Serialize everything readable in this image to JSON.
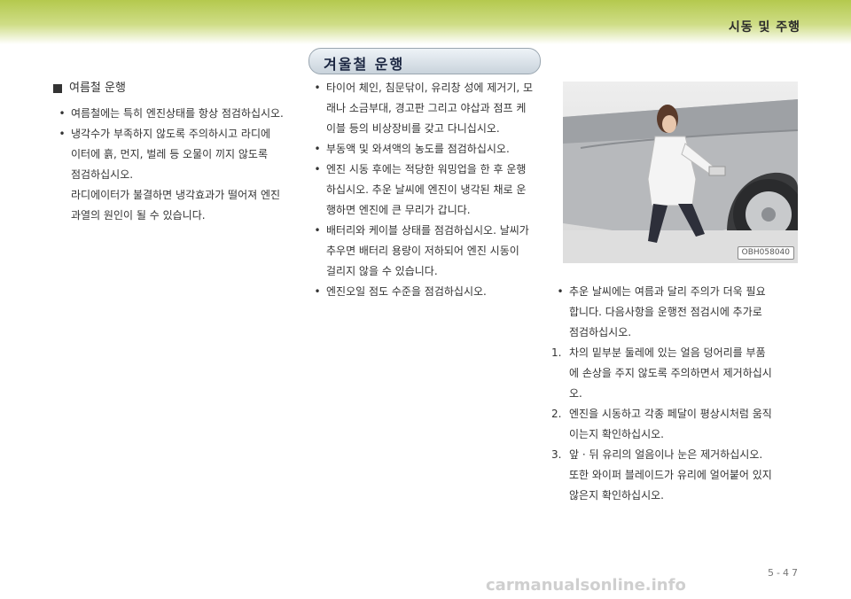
{
  "header": {
    "section_title": "시동 및 주행"
  },
  "banner": {
    "title": "겨울철 운행"
  },
  "summer": {
    "heading": "여름철 운행",
    "items": [
      {
        "lines": [
          "여름철에는 특히 엔진상태를 항상 점검하십시오."
        ]
      },
      {
        "lines": [
          "냉각수가 부족하지 않도록 주의하시고 라디에",
          "이터에 흙, 먼지, 벌레 등 오물이 끼지 않도록",
          "점검하십시오.",
          "라디에이터가 불결하면 냉각효과가 떨어져 엔진",
          "과열의 원인이 될 수 있습니다."
        ]
      }
    ]
  },
  "winter": {
    "items": [
      {
        "lines": [
          "타이어 체인, 침문닦이, 유리창 성에 제거기, 모",
          "래나 소금부대, 경고판 그리고 야삽과 점프 케",
          "이블 등의 비상장비를 갖고 다니십시오."
        ]
      },
      {
        "lines": [
          "부동액 및 와셔액의 농도를 점검하십시오."
        ]
      },
      {
        "lines": [
          "엔진 시동 후에는 적당한 워밍업을 한 후 운행",
          "하십시오. 추운 날씨에 엔진이 냉각된 채로 운",
          "행하면 엔진에 큰 무리가 갑니다."
        ]
      },
      {
        "lines": [
          "배터리와 케이블 상태를 점검하십시오. 날씨가",
          "추우면 배터리 용량이 저하되어 엔진 시동이",
          "걸리지 않을 수 있습니다."
        ]
      },
      {
        "lines": [
          "엔진오일 점도 수준을 점검하십시오."
        ]
      }
    ]
  },
  "figure": {
    "code": "OBH058040"
  },
  "notes": {
    "bullet": {
      "lines": [
        "추운 날씨에는 여름과 달리 주의가 더욱 필요",
        "합니다. 다음사항을 운행전 점검시에 추가로",
        "점검하십시오."
      ]
    },
    "numbered": [
      {
        "num": "1.",
        "lines": [
          "차의 밑부분 둘레에 있는 얼음 덩어리를 부품",
          "에 손상을 주지 않도록 주의하면서 제거하십시",
          "오."
        ]
      },
      {
        "num": "2.",
        "lines": [
          "엔진을 시동하고 각종 페달이 평상시처럼 움직",
          "이는지 확인하십시오."
        ]
      },
      {
        "num": "3.",
        "lines": [
          "앞 · 뒤 유리의 얼음이나 눈은 제거하십시오.",
          "또한 와이퍼 블레이드가 유리에 얼어붙어 있지",
          "않은지 확인하십시오."
        ]
      }
    ]
  },
  "footer": {
    "page": "5-47",
    "watermark": "carmanualsonline.info"
  },
  "colors": {
    "header_green": "#b4c94e",
    "banner_bg": "#c9d3dc",
    "banner_text": "#1a2540"
  },
  "icons": {
    "section_marker": "square-bullet-icon",
    "bullet": "bullet-dot-icon"
  }
}
